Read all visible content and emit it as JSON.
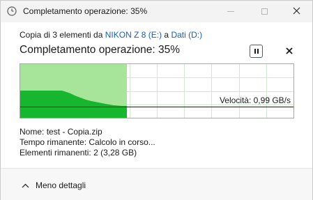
{
  "window": {
    "title": "Completamento operazione: 35%",
    "title_icon": "copy-progress-icon"
  },
  "source": {
    "prefix": "Copia di 3 elementi da ",
    "from": "NIKON Z 8  (E:)",
    "connector": " a ",
    "to": "Dati (D:)"
  },
  "heading": "Completamento operazione: 35%",
  "progress": {
    "percent": 35,
    "speed_label": "Velocità: 0,99 GB/s"
  },
  "details": {
    "name_label": "Nome:",
    "name_value": "test - Copia.zip",
    "time_label": "Tempo rimanente:",
    "time_value": "Calcolo in corso...",
    "items_label": "Elementi rimanenti:",
    "items_value": "2 (3,28 GB)"
  },
  "footer": {
    "less_details": "Meno dettagli"
  },
  "colors": {
    "progress_fill": "#a7e59b",
    "speed_fill": "#16b62e",
    "grid": "#cfe8cf",
    "link": "#1a5fb4"
  }
}
